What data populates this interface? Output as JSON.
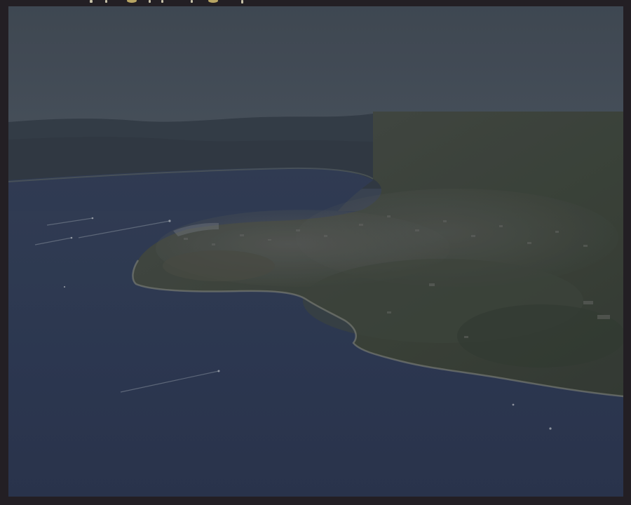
{
  "image": {
    "subject": "aerial-photograph-coastal-peninsula",
    "colors": {
      "frame": "#231f24",
      "sky": "#424b55",
      "sea": "#2b3650",
      "land": "#3b4236",
      "mountains": "#2f3740"
    }
  }
}
